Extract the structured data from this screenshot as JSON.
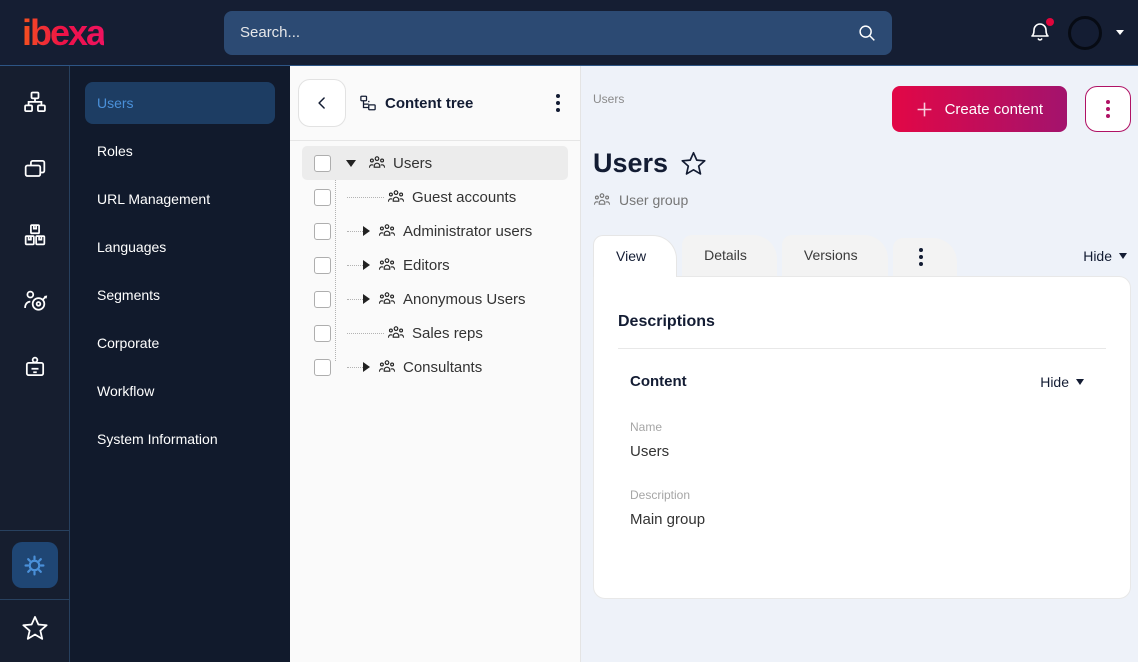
{
  "topbar": {
    "logo": "ibexa",
    "search": {
      "placeholder": "Search..."
    },
    "notifications": {
      "has_unread": true
    }
  },
  "icon_rail": {
    "items": [
      {
        "icon": "content-structure-icon"
      },
      {
        "icon": "pages-icon"
      },
      {
        "icon": "products-icon"
      },
      {
        "icon": "personalization-icon"
      },
      {
        "icon": "admin-badge-icon"
      }
    ],
    "bottom": [
      {
        "icon": "gear-icon",
        "active": true
      },
      {
        "icon": "star-icon",
        "active": false
      }
    ]
  },
  "sidebar": {
    "items": [
      {
        "label": "Users",
        "active": true
      },
      {
        "label": "Roles",
        "active": false
      },
      {
        "label": "URL Management",
        "active": false
      },
      {
        "label": "Languages",
        "active": false
      },
      {
        "label": "Segments",
        "active": false
      },
      {
        "label": "Corporate",
        "active": false
      },
      {
        "label": "Workflow",
        "active": false
      },
      {
        "label": "System Information",
        "active": false
      }
    ]
  },
  "content_tree": {
    "title": "Content tree",
    "items": [
      {
        "label": "Users",
        "caret": "down",
        "root": true,
        "selected": true,
        "icon": "user-group-icon"
      },
      {
        "label": "Guest accounts",
        "caret": "none",
        "icon": "user-group-icon"
      },
      {
        "label": "Administrator users",
        "caret": "right",
        "icon": "user-group-icon"
      },
      {
        "label": "Editors",
        "caret": "right",
        "icon": "user-group-icon"
      },
      {
        "label": "Anonymous Users",
        "caret": "right",
        "icon": "user-group-icon"
      },
      {
        "label": "Sales reps",
        "caret": "none",
        "icon": "user-group-icon"
      },
      {
        "label": "Consultants",
        "caret": "right",
        "icon": "user-group-icon"
      }
    ]
  },
  "main": {
    "breadcrumb": "Users",
    "create_button": "Create content",
    "title": "Users",
    "content_type": "User group",
    "tabs": [
      {
        "label": "View",
        "active": true
      },
      {
        "label": "Details",
        "active": false
      },
      {
        "label": "Versions",
        "active": false
      }
    ],
    "hide_label": "Hide",
    "descriptions": {
      "title": "Descriptions",
      "content_section": {
        "title": "Content",
        "hide_label": "Hide",
        "fields": [
          {
            "label": "Name",
            "value": "Users"
          },
          {
            "label": "Description",
            "value": "Main group"
          }
        ]
      }
    }
  },
  "colors": {
    "topbar_bg": "#151e33",
    "accent_gradient_start": "#e20746",
    "accent_gradient_end": "#a3136d",
    "active_item_bg": "#1d3d63",
    "active_item_text": "#4a90d9"
  }
}
